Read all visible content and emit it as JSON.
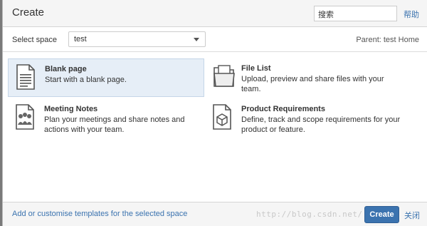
{
  "dialog": {
    "title": "Create",
    "search_placeholder": "搜索",
    "help_link": "帮助"
  },
  "space": {
    "label": "Select space",
    "selected": "test",
    "parent": "Parent: test Home"
  },
  "templates": [
    {
      "name": "Blank page",
      "description": "Start with a blank page.",
      "icon": "blank-page-icon",
      "selected": true
    },
    {
      "name": "File List",
      "description": "Upload, preview and share files with your team.",
      "icon": "folder-icon",
      "selected": false
    },
    {
      "name": "Meeting Notes",
      "description": "Plan your meetings and share notes and actions with your team.",
      "icon": "meeting-notes-icon",
      "selected": false
    },
    {
      "name": "Product Requirements",
      "description": "Define, track and scope requirements for your product or feature.",
      "icon": "product-requirements-icon",
      "selected": false
    }
  ],
  "footer": {
    "customise_link": "Add or customise templates for the selected space",
    "watermark": "http://blog.csdn.net/",
    "create_button": "Create",
    "close_link": "关闭"
  },
  "colors": {
    "accent": "#3b73af",
    "selected_bg": "#e6eef7"
  }
}
